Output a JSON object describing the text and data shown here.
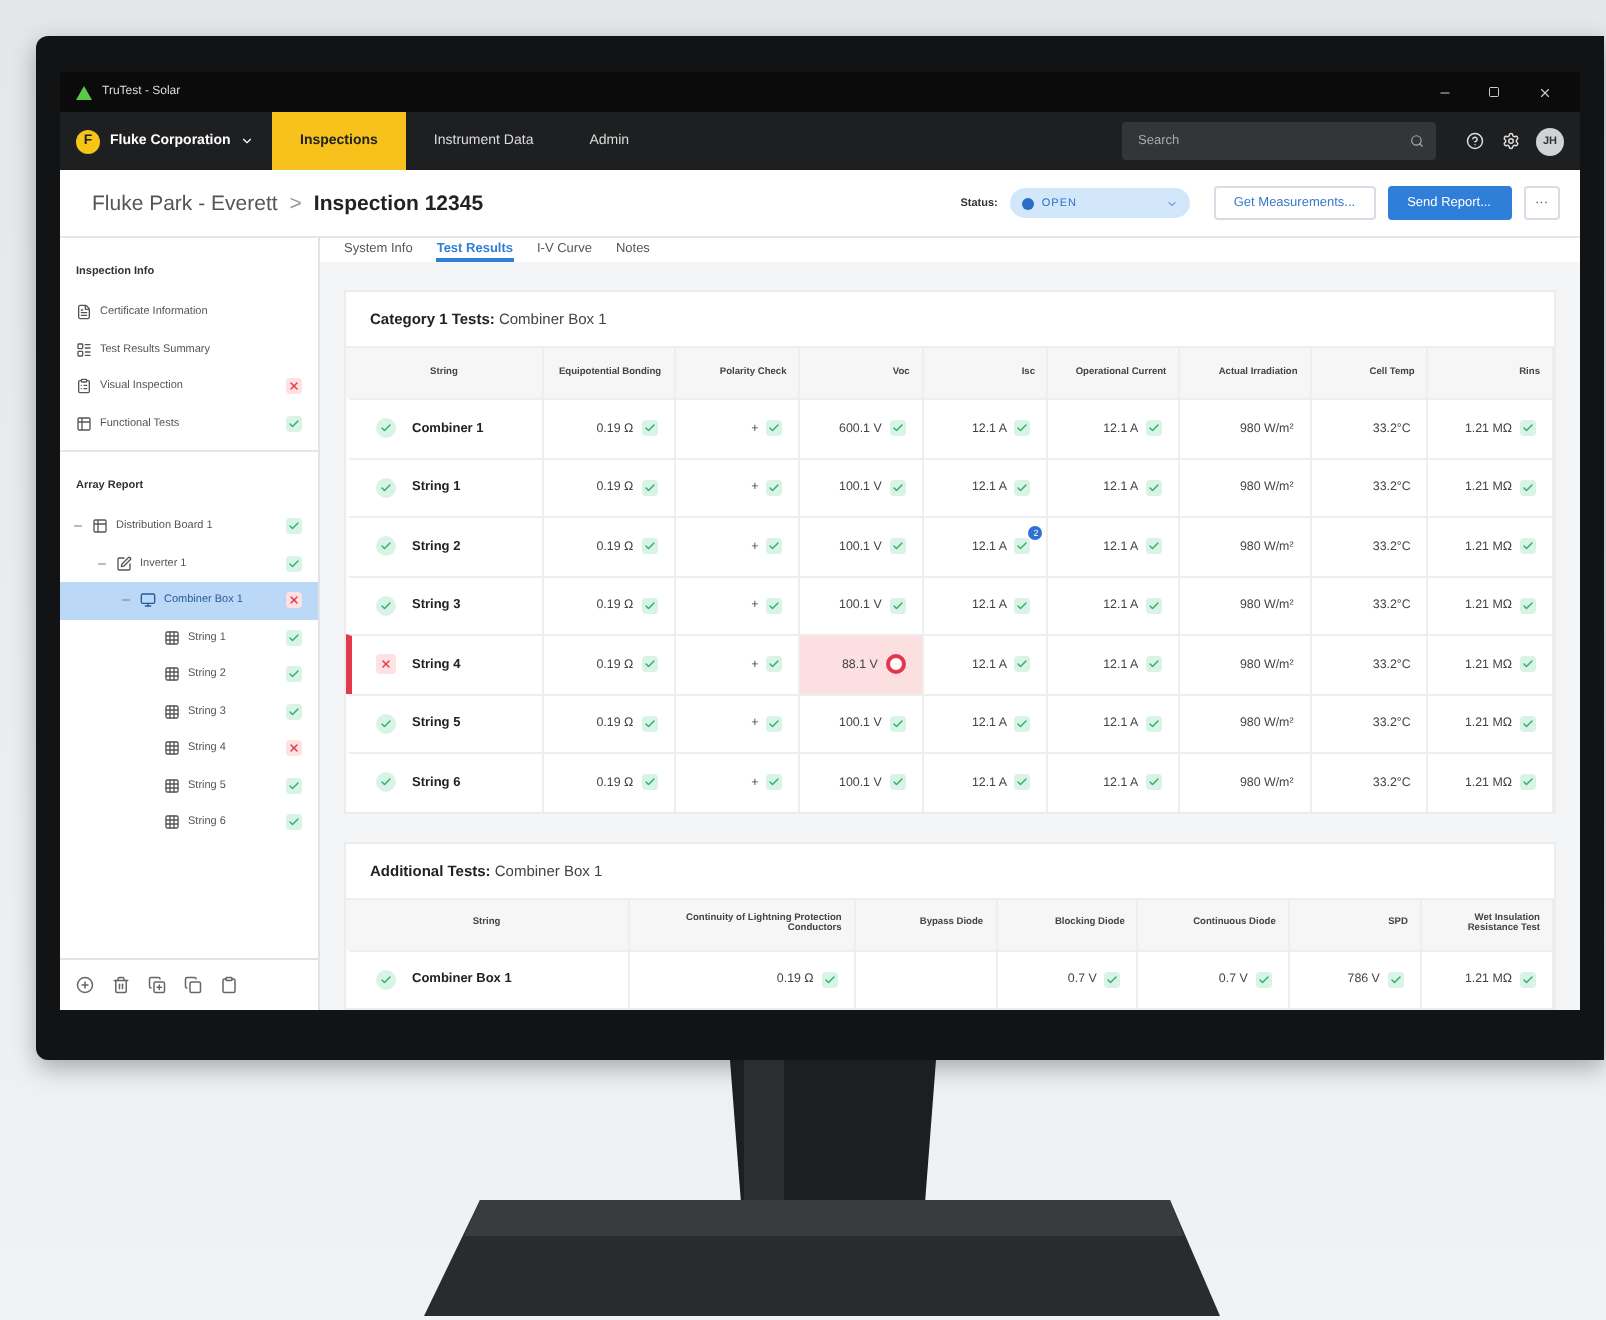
{
  "window": {
    "title": "TruTest - Solar"
  },
  "nav": {
    "org_initial": "F",
    "org": "Fluke Corporation",
    "tabs": [
      {
        "label": "Inspections",
        "selected": true
      },
      {
        "label": "Instrument Data",
        "selected": false
      },
      {
        "label": "Admin",
        "selected": false
      }
    ],
    "search": {
      "placeholder": "Search"
    },
    "avatar": "JH"
  },
  "header": {
    "parent": "Fluke Park - Everett",
    "separator": ">",
    "current": "Inspection 12345",
    "status_label": "Status:",
    "status": "OPEN",
    "buttons": [
      {
        "label": "Get Measurements...",
        "kind": "secondary"
      },
      {
        "label": "Send Report...",
        "kind": "primary"
      },
      {
        "label": "···",
        "kind": "more"
      }
    ]
  },
  "sidebar": {
    "info_title": "Inspection Info",
    "info_items": [
      {
        "label": "Certificate Information"
      },
      {
        "label": "Test Results Summary"
      },
      {
        "label": "Visual Inspection",
        "ok": false
      },
      {
        "label": "Functional Tests",
        "ok": true
      }
    ],
    "tree_title": "Array Report",
    "tree": [
      {
        "label": "Distribution Board 1",
        "ok": true,
        "expanded": true,
        "selected": false,
        "children": [
          {
            "label": "Inverter 1",
            "ok": true,
            "expanded": true,
            "selected": false,
            "children": [
              {
                "label": "Combiner Box 1",
                "ok": false,
                "expanded": true,
                "selected": true,
                "children": [
                  {
                    "label": "String 1",
                    "ok": true,
                    "selected": false
                  },
                  {
                    "label": "String 2",
                    "ok": true,
                    "selected": false
                  },
                  {
                    "label": "String 3",
                    "ok": true,
                    "selected": false
                  },
                  {
                    "label": "String 4",
                    "ok": false,
                    "selected": false
                  },
                  {
                    "label": "String 5",
                    "ok": true,
                    "selected": false
                  },
                  {
                    "label": "String 6",
                    "ok": true,
                    "selected": false
                  }
                ]
              }
            ]
          }
        ]
      }
    ]
  },
  "tabs": [
    {
      "label": "System Info",
      "selected": false
    },
    {
      "label": "Test Results",
      "selected": true
    },
    {
      "label": "I-V Curve",
      "selected": false
    },
    {
      "label": "Notes",
      "selected": false
    }
  ],
  "cards": [
    {
      "title": "**Category 1 Tests:** Combiner Box 1",
      "columns": [
        "String",
        "Equipotential Bonding",
        "Polarity Check",
        "Voc",
        "Isc",
        "Operational Current",
        "Actual Irradiation",
        "Cell Temp",
        "Rins"
      ],
      "rows": [
        {
          "cells": [
            {
              "text": "Combiner 1",
              "ok": true
            },
            {
              "text": "0.19 Ω",
              "ok": true
            },
            {
              "text": "+",
              "ok": true
            },
            {
              "text": "600.1 V",
              "ok": true
            },
            {
              "text": "12.1 A",
              "ok": true
            },
            {
              "text": "12.1 A",
              "ok": true
            },
            {
              "text": "980 W/m²"
            },
            {
              "text": "33.2°C"
            },
            {
              "text": "1.21 MΩ",
              "ok": true
            }
          ]
        },
        {
          "cells": [
            {
              "text": "String 1",
              "ok": true
            },
            {
              "text": "0.19 Ω",
              "ok": true
            },
            {
              "text": "+",
              "ok": true
            },
            {
              "text": "100.1 V",
              "ok": true
            },
            {
              "text": "12.1 A",
              "ok": true
            },
            {
              "text": "12.1 A",
              "ok": true
            },
            {
              "text": "980 W/m²"
            },
            {
              "text": "33.2°C"
            },
            {
              "text": "1.21 MΩ",
              "ok": true
            }
          ]
        },
        {
          "cells": [
            {
              "text": "String 2",
              "ok": true
            },
            {
              "text": "0.19 Ω",
              "ok": true
            },
            {
              "text": "+",
              "ok": true
            },
            {
              "text": "100.1 V",
              "ok": true
            },
            {
              "text": "12.1 A",
              "ok": true,
              "badge": "2"
            },
            {
              "text": "12.1 A",
              "ok": true
            },
            {
              "text": "980 W/m²"
            },
            {
              "text": "33.2°C"
            },
            {
              "text": "1.21 MΩ",
              "ok": true
            }
          ]
        },
        {
          "cells": [
            {
              "text": "String 3",
              "ok": true
            },
            {
              "text": "0.19 Ω",
              "ok": true
            },
            {
              "text": "+",
              "ok": true
            },
            {
              "text": "100.1 V",
              "ok": true
            },
            {
              "text": "12.1 A",
              "ok": true
            },
            {
              "text": "12.1 A",
              "ok": true
            },
            {
              "text": "980 W/m²"
            },
            {
              "text": "33.2°C"
            },
            {
              "text": "1.21 MΩ",
              "ok": true
            }
          ]
        },
        {
          "cells": [
            {
              "text": "String 4",
              "ok": false
            },
            {
              "text": "0.19 Ω",
              "ok": true
            },
            {
              "text": "+",
              "ok": true
            },
            {
              "text": "88.1 V",
              "ok": false
            },
            {
              "text": "12.1 A",
              "ok": true
            },
            {
              "text": "12.1 A",
              "ok": true
            },
            {
              "text": "980 W/m²"
            },
            {
              "text": "33.2°C"
            },
            {
              "text": "1.21 MΩ",
              "ok": true
            }
          ]
        },
        {
          "cells": [
            {
              "text": "String 5",
              "ok": true
            },
            {
              "text": "0.19 Ω",
              "ok": true
            },
            {
              "text": "+",
              "ok": true
            },
            {
              "text": "100.1 V",
              "ok": true
            },
            {
              "text": "12.1 A",
              "ok": true
            },
            {
              "text": "12.1 A",
              "ok": true
            },
            {
              "text": "980 W/m²"
            },
            {
              "text": "33.2°C"
            },
            {
              "text": "1.21 MΩ",
              "ok": true
            }
          ]
        },
        {
          "cells": [
            {
              "text": "String 6",
              "ok": true
            },
            {
              "text": "0.19 Ω",
              "ok": true
            },
            {
              "text": "+",
              "ok": true
            },
            {
              "text": "100.1 V",
              "ok": true
            },
            {
              "text": "12.1 A",
              "ok": true
            },
            {
              "text": "12.1 A",
              "ok": true
            },
            {
              "text": "980 W/m²"
            },
            {
              "text": "33.2°C"
            },
            {
              "text": "1.21 MΩ",
              "ok": true
            }
          ]
        }
      ]
    },
    {
      "title": "**Additional Tests:** Combiner Box 1",
      "columns": [
        "String",
        "Continuity of Lightning Protection Conductors",
        "Bypass Diode",
        "Blocking Diode",
        "Continuous Diode",
        "SPD",
        "Wet Insulation Resistance Test"
      ],
      "rows": [
        {
          "cells": [
            {
              "text": "Combiner Box 1",
              "ok": true
            },
            {
              "text": "0.19 Ω",
              "ok": true
            },
            {
              "text": ""
            },
            {
              "text": "0.7 V",
              "ok": true
            },
            {
              "text": "0.7 V",
              "ok": true
            },
            {
              "text": "786 V",
              "ok": true
            },
            {
              "text": "1.21 MΩ",
              "ok": true
            }
          ]
        }
      ]
    }
  ]
}
